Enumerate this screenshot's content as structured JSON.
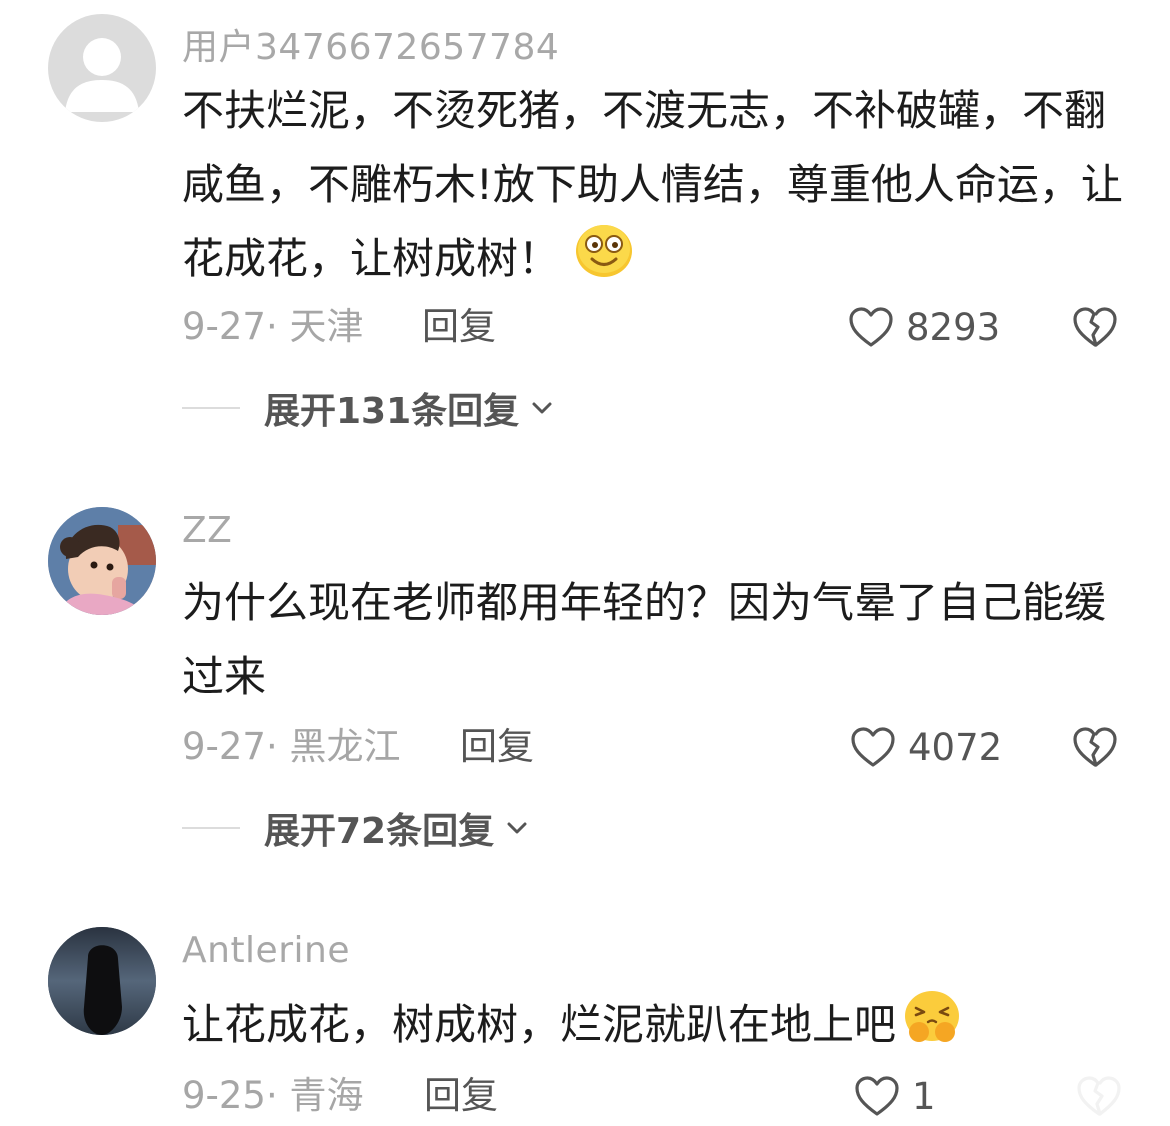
{
  "comments": [
    {
      "username": "用户3476672657784",
      "text": "不扶烂泥，不烫死猪，不渡无志，不补破罐，不翻咸鱼，不雕朽木!放下助人情结，尊重他人命运，让花成花，让树成树！",
      "date_location": "9-27· 天津",
      "reply_label": "回复",
      "likes": "8293",
      "expand_label": "展开131条回复"
    },
    {
      "username": "ZZ",
      "text": "为什么现在老师都用年轻的？因为气晕了自己能缓过来",
      "date_location": "9-27· 黑龙江",
      "reply_label": "回复",
      "likes": "4072",
      "expand_label": "展开72条回复"
    },
    {
      "username": "Antlerine",
      "text": "让花成花，树成树，烂泥就趴在地上吧",
      "date_location": "9-25· 青海",
      "reply_label": "回复",
      "likes": "1"
    }
  ],
  "icons": {
    "like": "heart-outline-icon",
    "dislike": "broken-heart-icon",
    "expand": "chevron-down-icon",
    "emoji_1": "smile-emoji",
    "emoji_3": "pleading-hands-emoji"
  },
  "colors": {
    "text": "#1c1c1c",
    "muted": "#a6a6a6",
    "action": "#555555"
  }
}
